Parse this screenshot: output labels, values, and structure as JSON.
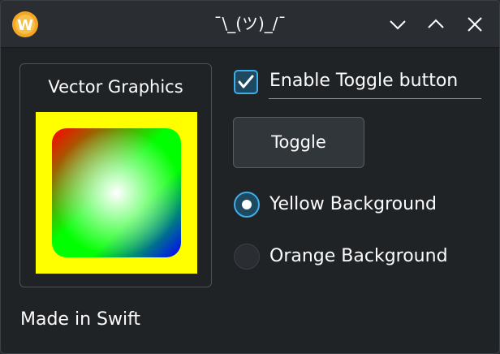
{
  "window": {
    "title": "¯\\_(ツ)_/¯",
    "icon_letter": "W",
    "icon_name": "app-w-icon",
    "controls": [
      "minimize-icon",
      "maximize-icon",
      "close-icon"
    ]
  },
  "group": {
    "title": "Vector Graphics",
    "canvas": {
      "background": "#ffff00",
      "corner_colors": [
        "#ff0000",
        "#00ff00",
        "#00ff00",
        "#0000ff"
      ],
      "center_glow": "#ffffff"
    }
  },
  "footer": {
    "label": "Made in Swift"
  },
  "options": {
    "enable_toggle": {
      "label": "Enable Toggle button",
      "checked": true
    },
    "toggle_button": {
      "label": "Toggle"
    },
    "radios": [
      {
        "label": "Yellow Background",
        "selected": true
      },
      {
        "label": "Orange Background",
        "selected": false
      }
    ]
  },
  "colors": {
    "accent": "#3daee9",
    "window_bg": "#202326",
    "titlebar_bg": "#2a2e32",
    "text": "#fcfcfc"
  }
}
